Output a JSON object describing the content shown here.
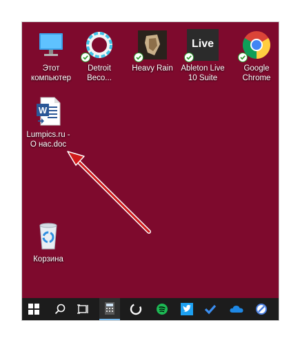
{
  "desktop": {
    "background_color": "#7e0a2d",
    "icons": [
      {
        "label": "Этот\nкомпьютер",
        "icon": "computer-icon",
        "synced": false
      },
      {
        "label": "Detroit\nBeco...",
        "icon": "detroit-icon",
        "synced": true
      },
      {
        "label": "Heavy Rain",
        "icon": "heavy-rain-icon",
        "synced": true
      },
      {
        "label": "Ableton Live\n10 Suite",
        "icon": "ableton-icon",
        "synced": true,
        "badge_text": "Live"
      },
      {
        "label": "Google\nChrome",
        "icon": "chrome-icon",
        "synced": true
      },
      {
        "label": "Lumpics.ru -\nО нас.doc",
        "icon": "word-document-icon",
        "synced": false
      },
      {
        "label": "Корзина",
        "icon": "recycle-bin-icon",
        "synced": false
      }
    ]
  },
  "annotation": {
    "type": "arrow",
    "color": "#d11a1a",
    "points_to": "Lumpics.ru - О нас.doc"
  },
  "taskbar": {
    "background": "#1c1c1c",
    "items": [
      "windows-start-icon",
      "search-icon",
      "task-view-icon",
      "calculator-icon",
      "cortana-icon",
      "spotify-icon",
      "twitter-icon",
      "todo-icon",
      "onedrive-icon",
      "browser-icon"
    ]
  }
}
